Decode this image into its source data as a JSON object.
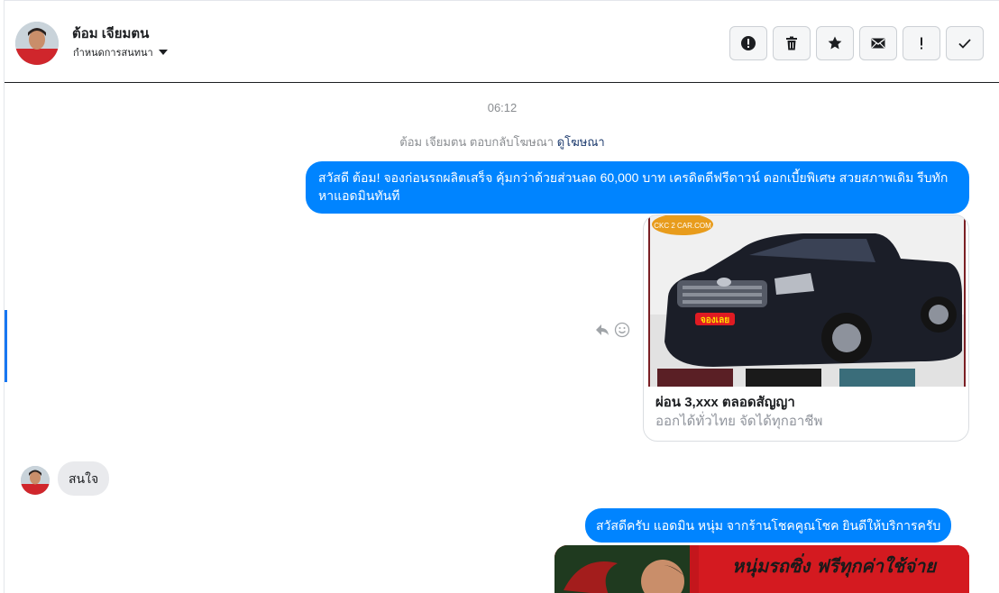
{
  "header": {
    "contact_name": "ต้อม เจียมตน",
    "assign_label": "กำหนดการสนทนา",
    "actions": [
      {
        "icon": "exclamation-circle-icon"
      },
      {
        "icon": "trash-icon"
      },
      {
        "icon": "star-icon"
      },
      {
        "icon": "envelope-icon"
      },
      {
        "icon": "exclamation-icon"
      },
      {
        "icon": "checkmark-icon"
      }
    ]
  },
  "thread": {
    "timestamp": "06:12",
    "reply_note": "ต้อม เจียมตน ตอบกลับโฆษณา",
    "reply_link": "ดูโฆษณา",
    "messages": [
      {
        "from": "page",
        "text": "สวัสดี ต้อม! จองก่อนรถผลิตเสร็จ คุ้มกว่าด้วยส่วนลด 60,000 บาท เครดิตดีฟรีดาวน์ ดอกเบี้ยพิเศษ สวยสภาพเดิม รีบทักหาแอดมินทันที"
      },
      {
        "from": "page",
        "type": "card",
        "title": "ผ่อน 3,xxx ตลอดสัญญา",
        "subtitle": "ออกได้ทั่วไทย จัดได้ทุกอาชีพ",
        "image_badge": "จองเลย",
        "image_logo": "CKC 2 CAR.COM"
      },
      {
        "from": "contact",
        "text": "สนใจ"
      },
      {
        "from": "page",
        "text": "สวัสดีครับ แอดมิน หนุ่ม จากร้านโชคคูณโชค ยินดีให้บริการครับ"
      },
      {
        "from": "page",
        "type": "image",
        "banner_text": "หนุ่มรถซิ่ง ฟรีทุกค่าใช้จ่าย"
      }
    ]
  },
  "colors": {
    "accent": "#0084ff",
    "incoming_bubble": "#e9eaed",
    "muted_text": "#8a8d91",
    "link": "#1d3b6e"
  }
}
